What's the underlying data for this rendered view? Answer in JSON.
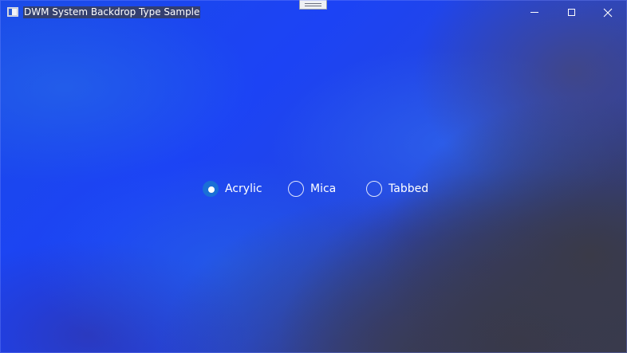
{
  "window": {
    "title": "DWM System Backdrop Type Sample",
    "accent_color": "#1a6fd6",
    "backdrop_color": "#1f45ee",
    "caption_buttons": [
      "minimize-icon",
      "maximize-icon",
      "close-icon"
    ]
  },
  "backdrop_options": {
    "selected": "Acrylic",
    "items": [
      {
        "label": "Acrylic",
        "checked": true
      },
      {
        "label": "Mica",
        "checked": false
      },
      {
        "label": "Tabbed",
        "checked": false
      }
    ]
  }
}
